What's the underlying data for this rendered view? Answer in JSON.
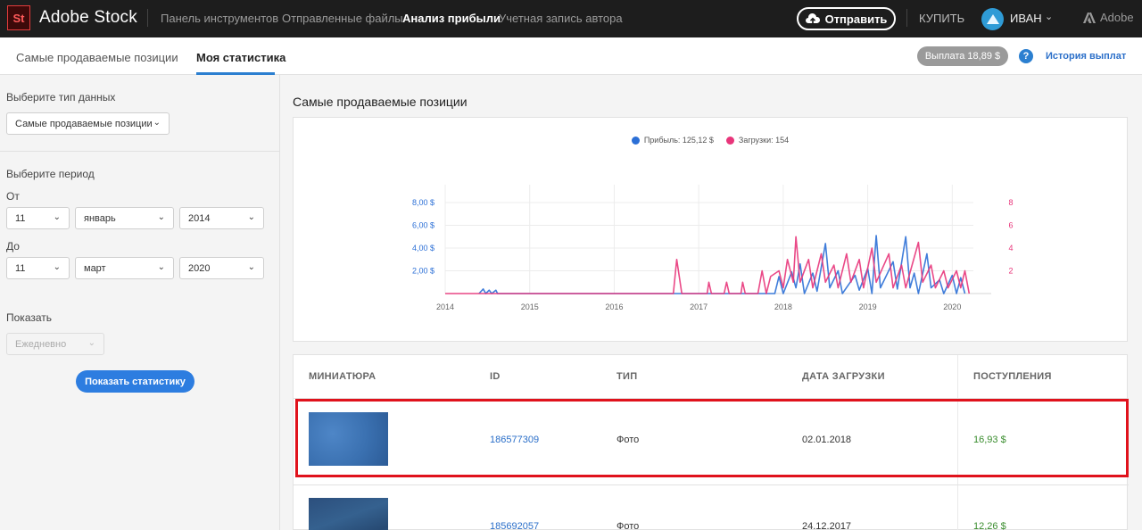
{
  "topbar": {
    "logo": "St",
    "brand": "Adobe Stock",
    "nav": [
      "Панель инструментов",
      "Отправленные файлы",
      "Анализ прибыли",
      "Учетная запись автора"
    ],
    "send_label": "Отправить",
    "buy_label": "КУПИТЬ",
    "user_name": "ИВАН",
    "adobe_label": "Adobe"
  },
  "subnav": {
    "tabs": [
      "Самые продаваемые позиции",
      "Моя статистика"
    ],
    "active_tab": "Моя статистика",
    "payout": "Выплата 18,89 $",
    "history_link": "История выплат"
  },
  "sidebar": {
    "data_type_label": "Выберите тип данных",
    "data_type_value": "Самые продаваемые позиции",
    "period_label": "Выберите период",
    "from_label": "От",
    "from": {
      "day": "11",
      "month": "январь",
      "year": "2014"
    },
    "to_label": "До",
    "to": {
      "day": "11",
      "month": "март",
      "year": "2020"
    },
    "show_label": "Показать",
    "show_value": "Ежедневно",
    "show_button": "Показать статистику"
  },
  "main": {
    "title": "Самые продаваемые позиции"
  },
  "chart_data": {
    "type": "line",
    "legend": [
      {
        "name": "Прибыль: 125,12 $",
        "color": "#2b6fd6"
      },
      {
        "name": "Загрузки: 154",
        "color": "#e8357a"
      }
    ],
    "x_ticks": [
      "2014",
      "2015",
      "2016",
      "2017",
      "2018",
      "2019",
      "2020"
    ],
    "y_left_ticks": [
      "2,00 $",
      "4,00 $",
      "6,00 $",
      "8,00 $"
    ],
    "y_right_ticks": [
      "2",
      "4",
      "6",
      "8"
    ],
    "y_left_range": [
      0,
      8
    ],
    "y_right_range": [
      0,
      8
    ],
    "x_range": [
      2014,
      2020.25
    ],
    "series": [
      {
        "name": "Прибыль: 125,12 $",
        "axis": "left",
        "color": "#2b6fd6",
        "points": [
          [
            2014.4,
            0
          ],
          [
            2014.45,
            0.4
          ],
          [
            2014.48,
            0
          ],
          [
            2014.52,
            0.3
          ],
          [
            2014.55,
            0
          ],
          [
            2014.6,
            0.3
          ],
          [
            2014.62,
            0
          ],
          [
            2017.9,
            0
          ],
          [
            2017.95,
            1.5
          ],
          [
            2018.0,
            0
          ],
          [
            2018.1,
            1.9
          ],
          [
            2018.15,
            0.5
          ],
          [
            2018.2,
            2.6
          ],
          [
            2018.25,
            0
          ],
          [
            2018.35,
            1.8
          ],
          [
            2018.4,
            0.2
          ],
          [
            2018.5,
            4.4
          ],
          [
            2018.55,
            0.5
          ],
          [
            2018.65,
            2.0
          ],
          [
            2018.7,
            0
          ],
          [
            2018.85,
            1.6
          ],
          [
            2018.9,
            0.3
          ],
          [
            2019.0,
            2.2
          ],
          [
            2019.05,
            0
          ],
          [
            2019.1,
            5.1
          ],
          [
            2019.15,
            0.5
          ],
          [
            2019.3,
            2.8
          ],
          [
            2019.35,
            0.4
          ],
          [
            2019.45,
            5.0
          ],
          [
            2019.5,
            0.5
          ],
          [
            2019.55,
            1.8
          ],
          [
            2019.6,
            0
          ],
          [
            2019.7,
            3.5
          ],
          [
            2019.75,
            0.5
          ],
          [
            2019.85,
            1.2
          ],
          [
            2019.9,
            0
          ],
          [
            2020.0,
            1.6
          ],
          [
            2020.05,
            0
          ],
          [
            2020.1,
            1.4
          ],
          [
            2020.15,
            0
          ]
        ]
      },
      {
        "name": "Загрузки: 154",
        "axis": "right",
        "color": "#e8357a",
        "points": [
          [
            2014.0,
            0
          ],
          [
            2016.7,
            0
          ],
          [
            2016.74,
            3
          ],
          [
            2016.8,
            0
          ],
          [
            2017.1,
            0
          ],
          [
            2017.12,
            1
          ],
          [
            2017.15,
            0
          ],
          [
            2017.3,
            0
          ],
          [
            2017.33,
            1
          ],
          [
            2017.36,
            0
          ],
          [
            2017.5,
            0
          ],
          [
            2017.52,
            1
          ],
          [
            2017.55,
            0
          ],
          [
            2017.7,
            0
          ],
          [
            2017.75,
            2
          ],
          [
            2017.8,
            0
          ],
          [
            2017.85,
            1.5
          ],
          [
            2017.95,
            2
          ],
          [
            2018.0,
            0.5
          ],
          [
            2018.05,
            3
          ],
          [
            2018.12,
            1
          ],
          [
            2018.15,
            5
          ],
          [
            2018.2,
            1
          ],
          [
            2018.3,
            3
          ],
          [
            2018.35,
            0.5
          ],
          [
            2018.45,
            3.5
          ],
          [
            2018.5,
            1
          ],
          [
            2018.6,
            2.5
          ],
          [
            2018.65,
            0.5
          ],
          [
            2018.75,
            3.5
          ],
          [
            2018.8,
            1
          ],
          [
            2018.9,
            3
          ],
          [
            2018.95,
            0.5
          ],
          [
            2019.05,
            4
          ],
          [
            2019.1,
            1
          ],
          [
            2019.25,
            3.5
          ],
          [
            2019.3,
            0.5
          ],
          [
            2019.4,
            2.5
          ],
          [
            2019.45,
            0.5
          ],
          [
            2019.6,
            4.5
          ],
          [
            2019.65,
            1
          ],
          [
            2019.75,
            2.5
          ],
          [
            2019.8,
            0.5
          ],
          [
            2019.9,
            2
          ],
          [
            2019.95,
            0.5
          ],
          [
            2020.05,
            2
          ],
          [
            2020.1,
            0.5
          ],
          [
            2020.15,
            2
          ],
          [
            2020.2,
            0
          ]
        ]
      }
    ]
  },
  "table": {
    "headers": [
      "МИНИАТЮРА",
      "ID",
      "ТИП",
      "ДАТА ЗАГРУЗКИ",
      "ПОСТУПЛЕНИЯ"
    ],
    "rows": [
      {
        "id": "186577309",
        "type": "Фото",
        "date": "02.01.2018",
        "income": "16,93 $"
      },
      {
        "id": "185692057",
        "type": "Фото",
        "date": "24.12.2017",
        "income": "12,26 $"
      }
    ]
  }
}
